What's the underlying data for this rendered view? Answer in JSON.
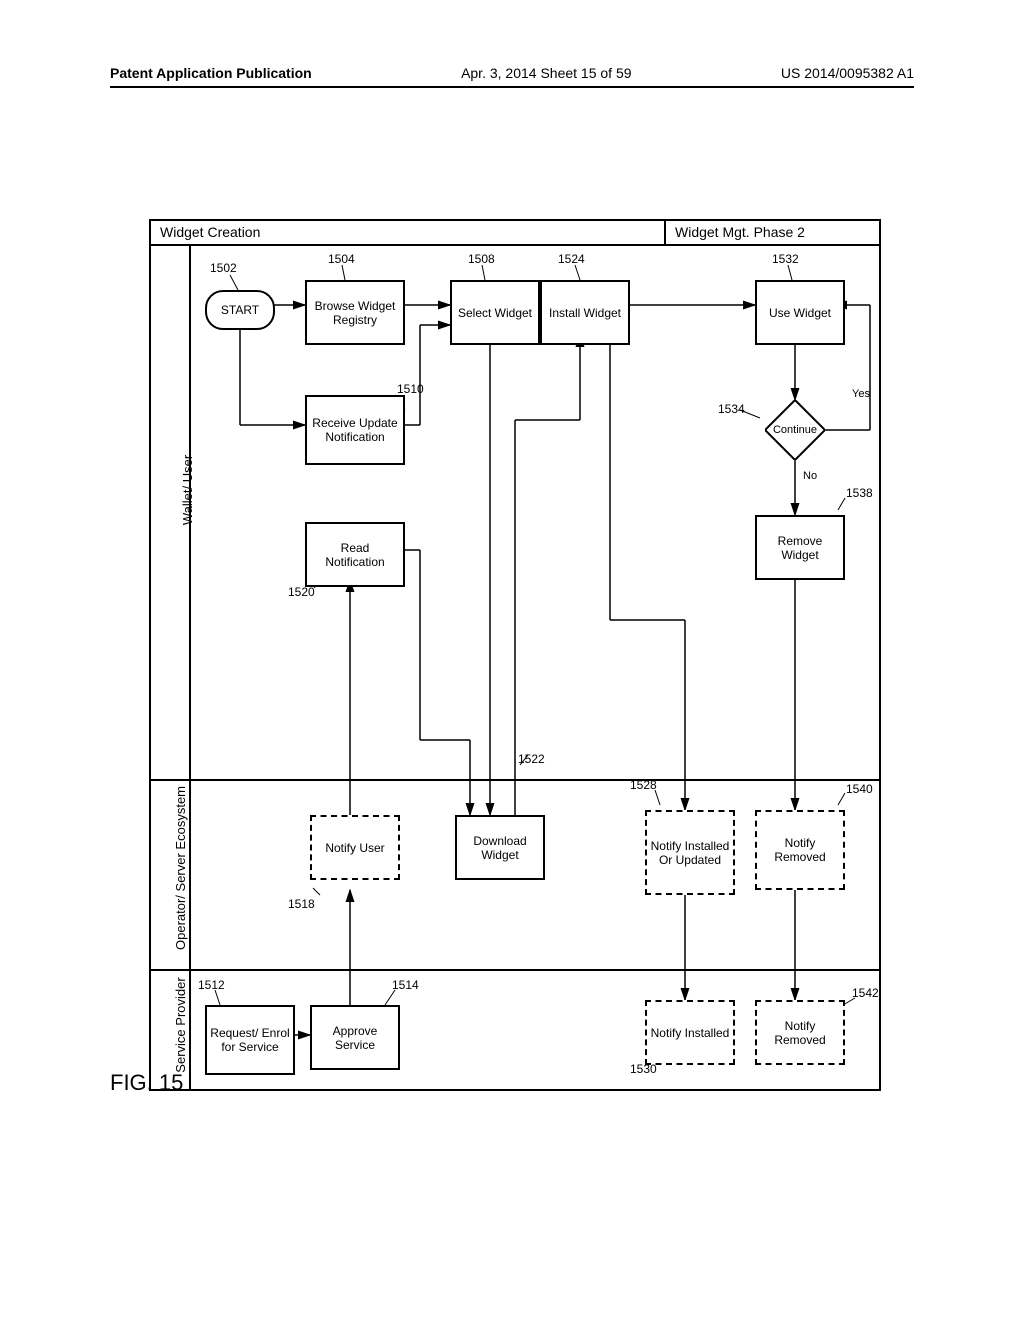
{
  "header": {
    "left": "Patent Application Publication",
    "mid": "Apr. 3, 2014  Sheet 15 of 59",
    "right": "US 2014/0095382 A1"
  },
  "figure_label": "FIG. 15",
  "phases": {
    "widget_creation": "Widget Creation",
    "widget_mgt_phase2": "Widget Mgt. Phase 2"
  },
  "lanes": {
    "wallet_user": "Wallet/ User",
    "operator_server": "Operator/ Server Ecosystem",
    "service_provider": "Service Provider"
  },
  "boxes": {
    "start": "START",
    "browse_registry": "Browse Widget Registry",
    "receive_update": "Receive Update Notification",
    "read_notification": "Read Notification",
    "select_widget": "Select Widget",
    "install_widget": "Install Widget",
    "use_widget": "Use Widget",
    "remove_widget": "Remove Widget",
    "notify_user": "Notify User",
    "download_widget": "Download Widget",
    "notify_installed_updated": "Notify Installed Or Updated",
    "notify_removed_1": "Notify Removed",
    "request_enrol": "Request/ Enrol for Service",
    "approve_service": "Approve Service",
    "notify_installed": "Notify Installed",
    "notify_removed_2": "Notify Removed"
  },
  "decision": {
    "continue": "Continue",
    "yes": "Yes",
    "no": "No"
  },
  "refs": {
    "1502": "1502",
    "1504": "1504",
    "1508": "1508",
    "1510": "1510",
    "1512": "1512",
    "1514": "1514",
    "1518": "1518",
    "1520": "1520",
    "1522": "1522",
    "1524": "1524",
    "1528": "1528",
    "1530": "1530",
    "1532": "1532",
    "1534": "1534",
    "1538": "1538",
    "1540": "1540",
    "1542": "1542"
  }
}
